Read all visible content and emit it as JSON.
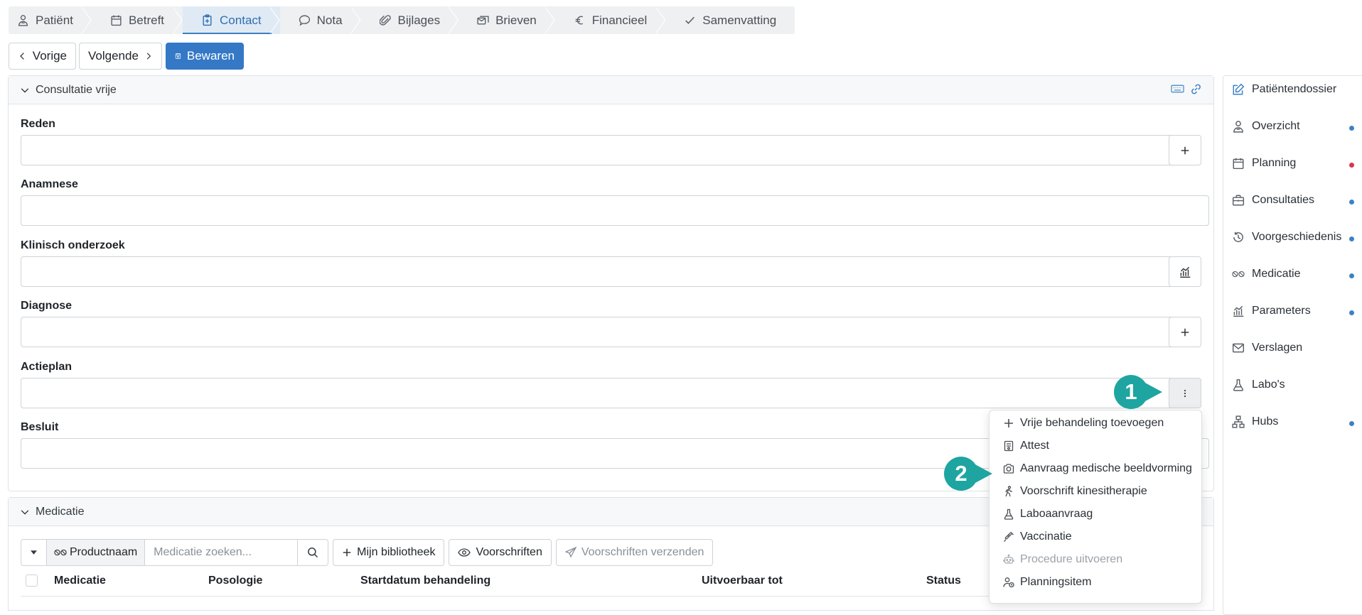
{
  "tabs": [
    {
      "label": "Patiënt",
      "icon": "person-icon"
    },
    {
      "label": "Betreft",
      "icon": "calendar-icon"
    },
    {
      "label": "Contact",
      "icon": "clipboard-plus-icon"
    },
    {
      "label": "Nota",
      "icon": "chat-bubble-icon"
    },
    {
      "label": "Bijlages",
      "icon": "paperclip-icon"
    },
    {
      "label": "Brieven",
      "icon": "letters-icon"
    },
    {
      "label": "Financieel",
      "icon": "euro-icon"
    },
    {
      "label": "Samenvatting",
      "icon": "check-icon"
    }
  ],
  "toolbar": {
    "previous": "Vorige",
    "next": "Volgende",
    "save": "Bewaren"
  },
  "consultation": {
    "title": "Consultatie vrije",
    "fields": {
      "reden": "Reden",
      "anamnese": "Anamnese",
      "klinisch": "Klinisch onderzoek",
      "diagnose": "Diagnose",
      "actieplan": "Actieplan",
      "besluit": "Besluit"
    }
  },
  "medication": {
    "title": "Medicatie",
    "product_label": "Productnaam",
    "search_placeholder": "Medicatie zoeken...",
    "library": "Mijn bibliotheek",
    "prescriptions": "Voorschriften",
    "send_prescriptions": "Voorschriften verzenden",
    "columns": [
      "Medicatie",
      "Posologie",
      "Startdatum behandeling",
      "Uitvoerbaar tot",
      "Status"
    ]
  },
  "sidebar": {
    "items": [
      {
        "label": "Patiëntendossier",
        "icon": "edit-icon",
        "dot": ""
      },
      {
        "label": "Overzicht",
        "icon": "person-icon",
        "dot": "#3b82c4"
      },
      {
        "label": "Planning",
        "icon": "calendar-icon",
        "dot": "#dc3545"
      },
      {
        "label": "Consultaties",
        "icon": "briefcase-icon",
        "dot": "#3b82c4"
      },
      {
        "label": "Voorgeschiedenis",
        "icon": "history-icon",
        "dot": "#3b82c4"
      },
      {
        "label": "Medicatie",
        "icon": "pills-icon",
        "dot": "#3b82c4"
      },
      {
        "label": "Parameters",
        "icon": "chart-icon",
        "dot": "#3b82c4"
      },
      {
        "label": "Verslagen",
        "icon": "mail-icon",
        "dot": ""
      },
      {
        "label": "Labo's",
        "icon": "flask-icon",
        "dot": ""
      },
      {
        "label": "Hubs",
        "icon": "network-icon",
        "dot": "#3b82c4"
      }
    ]
  },
  "menu": {
    "items": [
      {
        "label": "Vrije behandeling toevoegen",
        "icon": "plus-icon",
        "disabled": false
      },
      {
        "label": "Attest",
        "icon": "document-icon",
        "disabled": false
      },
      {
        "label": "Aanvraag medische beeldvorming",
        "icon": "camera-icon",
        "disabled": false
      },
      {
        "label": "Voorschrift kinesitherapie",
        "icon": "walking-icon",
        "disabled": false
      },
      {
        "label": "Laboaanvraag",
        "icon": "flask-icon",
        "disabled": false
      },
      {
        "label": "Vaccinatie",
        "icon": "syringe-icon",
        "disabled": false
      },
      {
        "label": "Procedure uitvoeren",
        "icon": "robot-icon",
        "disabled": true
      },
      {
        "label": "Planningsitem",
        "icon": "person-clock-icon",
        "disabled": false
      }
    ]
  },
  "callouts": {
    "one": "1",
    "two": "2"
  }
}
